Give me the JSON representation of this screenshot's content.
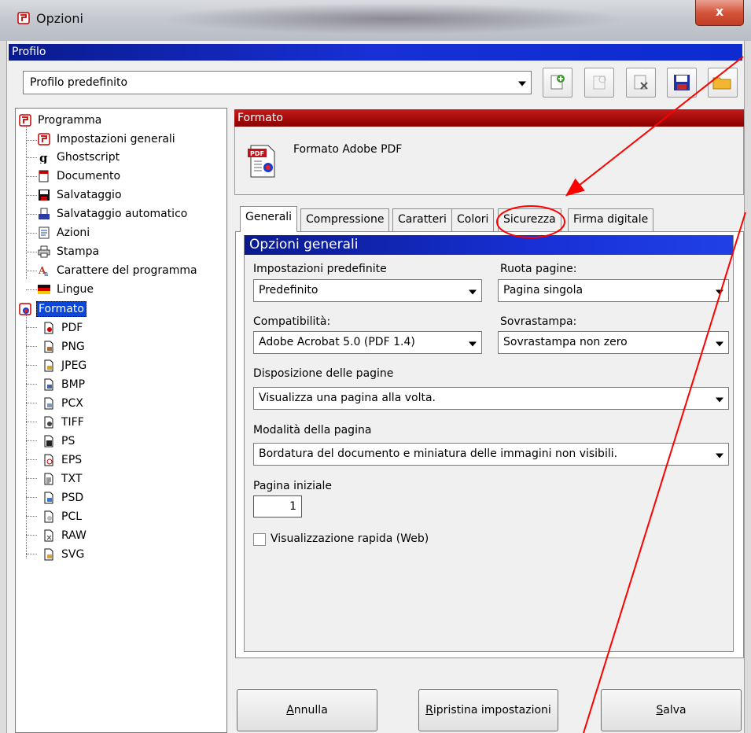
{
  "window": {
    "title": "Opzioni",
    "close_label": "x"
  },
  "profile": {
    "band_label": "Profilo",
    "selected": "Profilo predefinito",
    "toolbar_icons": [
      "add-profile-icon",
      "rename-profile-icon",
      "delete-profile-icon",
      "save-profile-icon",
      "open-profile-icon"
    ]
  },
  "tree": {
    "items": [
      {
        "label": "Programma",
        "icon": "program-icon"
      },
      {
        "label": "Impostazioni generali",
        "icon": "general-settings-icon"
      },
      {
        "label": "Ghostscript",
        "icon": "ghostscript-icon"
      },
      {
        "label": "Documento",
        "icon": "document-icon"
      },
      {
        "label": "Salvataggio",
        "icon": "save-icon"
      },
      {
        "label": "Salvataggio automatico",
        "icon": "autosave-icon"
      },
      {
        "label": "Azioni",
        "icon": "actions-icon"
      },
      {
        "label": "Stampa",
        "icon": "print-icon"
      },
      {
        "label": "Carattere del programma",
        "icon": "font-icon"
      },
      {
        "label": "Lingue",
        "icon": "language-flag-icon"
      },
      {
        "label": "Formato",
        "icon": "format-icon"
      },
      {
        "label": "PDF",
        "icon": "pdf-file-icon"
      },
      {
        "label": "PNG",
        "icon": "png-file-icon"
      },
      {
        "label": "JPEG",
        "icon": "jpeg-file-icon"
      },
      {
        "label": "BMP",
        "icon": "bmp-file-icon"
      },
      {
        "label": "PCX",
        "icon": "pcx-file-icon"
      },
      {
        "label": "TIFF",
        "icon": "tiff-file-icon"
      },
      {
        "label": "PS",
        "icon": "ps-file-icon"
      },
      {
        "label": "EPS",
        "icon": "eps-file-icon"
      },
      {
        "label": "TXT",
        "icon": "txt-file-icon"
      },
      {
        "label": "PSD",
        "icon": "psd-file-icon"
      },
      {
        "label": "PCL",
        "icon": "pcl-file-icon"
      },
      {
        "label": "RAW",
        "icon": "raw-file-icon"
      },
      {
        "label": "SVG",
        "icon": "svg-file-icon"
      }
    ]
  },
  "format": {
    "band_label": "Formato",
    "name": "Formato Adobe PDF",
    "icon_text": "PDF"
  },
  "tabs": [
    {
      "label": "Generali"
    },
    {
      "label": "Compressione"
    },
    {
      "label": "Caratteri"
    },
    {
      "label": "Colori"
    },
    {
      "label": "Sicurezza"
    },
    {
      "label": "Firma digitale"
    }
  ],
  "general": {
    "header": "Opzioni generali",
    "default_settings_label": "Impostazioni predefinite",
    "default_settings_value": "Predefinito",
    "rotate_label": "Ruota pagine:",
    "rotate_value": "Pagina singola",
    "compat_label": "Compatibilità:",
    "compat_value": "Adobe Acrobat 5.0 (PDF 1.4)",
    "overprint_label": "Sovrastampa:",
    "overprint_value": "Sovrastampa non zero",
    "layout_label": "Disposizione delle pagine",
    "layout_value": "Visualizza una pagina alla volta.",
    "mode_label": "Modalità della pagina",
    "mode_value": "Bordatura del documento e miniatura delle immagini non visibili.",
    "start_page_label": "Pagina iniziale",
    "start_page_value": "1",
    "fast_web_label": "Visualizzazione rapida (Web)",
    "fast_web_checked": false
  },
  "buttons": {
    "cancel_mnemonic": "A",
    "cancel_rest": "nnulla",
    "reset_mnemonic": "R",
    "reset_rest": "ipristina impostazioni",
    "save_mnemonic": "S",
    "save_rest": "alva"
  },
  "colors": {
    "profile_band": "#1830d6",
    "format_band": "#a80000",
    "annotation": "#ff0000"
  }
}
